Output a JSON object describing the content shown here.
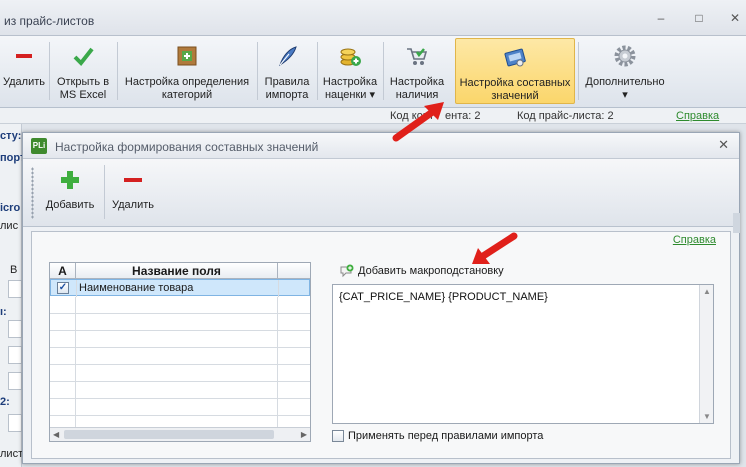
{
  "bg_window": {
    "title": "из прайс-листов",
    "minimize": "–",
    "restore": "□",
    "close": "✕"
  },
  "ribbon": {
    "buttons": [
      {
        "label": "Удалить",
        "icon": "minus-icon"
      },
      {
        "label": "Открыть в\nMS Excel",
        "icon": "check-icon"
      },
      {
        "label": "Настройка определения\nкатегорий",
        "icon": "categories-icon"
      },
      {
        "label": "Правила\nимпорта",
        "icon": "feather-icon"
      },
      {
        "label": "Настройка\nнаценки ▾",
        "icon": "coins-icon"
      },
      {
        "label": "Настройка\nналичия",
        "icon": "cart-icon"
      },
      {
        "label": "Настройка составных\nзначений",
        "icon": "composite-values-icon"
      },
      {
        "label": "Дополнительно\n▾",
        "icon": "gear-icon"
      }
    ],
    "status_left": "Код конт",
    "status_mid": "ента: 2",
    "status_right": "Код прайс-листа: 2",
    "help": "Справка"
  },
  "bg_left": {
    "label1": "сту:",
    "label2": "порт",
    "label3": "icro",
    "label4": "лис",
    "label5": "В",
    "label6": "ı:",
    "label7": "2:",
    "label8": "листе"
  },
  "dialog": {
    "logo": "PLi",
    "title": "Настройка формирования составных значений",
    "close": "✕",
    "toolbar": {
      "add_label": "Добавить",
      "delete_label": "Удалить"
    },
    "help": "Справка",
    "grid": {
      "col_a": "А",
      "col_name": "Название поля",
      "rows": [
        {
          "checked": "✓",
          "name": "Наименование товара"
        }
      ]
    },
    "macro_button": "Добавить макроподстановку",
    "macro_text": "{CAT_PRICE_NAME} {PRODUCT_NAME}",
    "apply_label": "Применять перед правилами импорта"
  },
  "colors": {
    "accent_green": "#2e8b2e",
    "highlight": "#fbd66b",
    "arrow_red": "#e0201a"
  }
}
